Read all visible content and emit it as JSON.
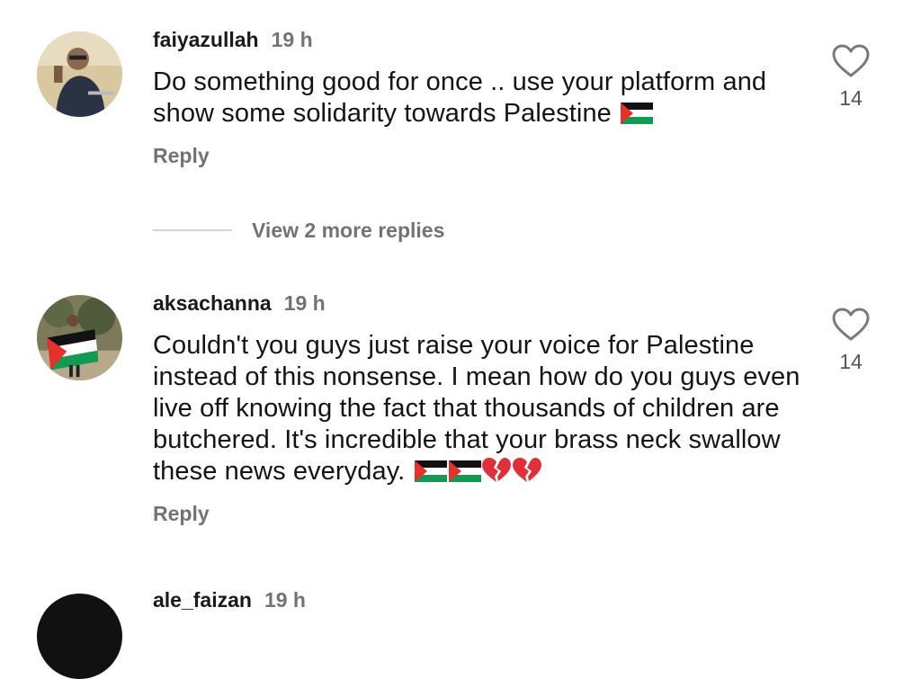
{
  "comments": [
    {
      "username": "faiyazullah",
      "time": "19 h",
      "text": "Do something good for once .. use your platform and show some solidarity towards Palestine",
      "emoji": [
        "palestine-flag"
      ],
      "reply_label": "Reply",
      "likes": "14"
    },
    {
      "username": "aksachanna",
      "time": "19 h",
      "text": "Couldn't you guys just raise your voice for Palestine instead of this nonsense. I mean how do you guys even live off knowing the fact that thousands of children are butchered. It's incredible that your brass neck swallow these news everyday.",
      "emoji": [
        "palestine-flag",
        "palestine-flag",
        "broken-heart",
        "broken-heart"
      ],
      "reply_label": "Reply",
      "likes": "14"
    },
    {
      "username": "ale_faizan",
      "time": "19 h"
    }
  ],
  "view_more_replies": "View 2 more replies",
  "icons": [
    "heart-outline-icon",
    "palestine-flag",
    "broken-heart"
  ],
  "colors": {
    "secondary_text": "#737373",
    "primary_text": "#141414",
    "divider": "#d4d4d4"
  }
}
